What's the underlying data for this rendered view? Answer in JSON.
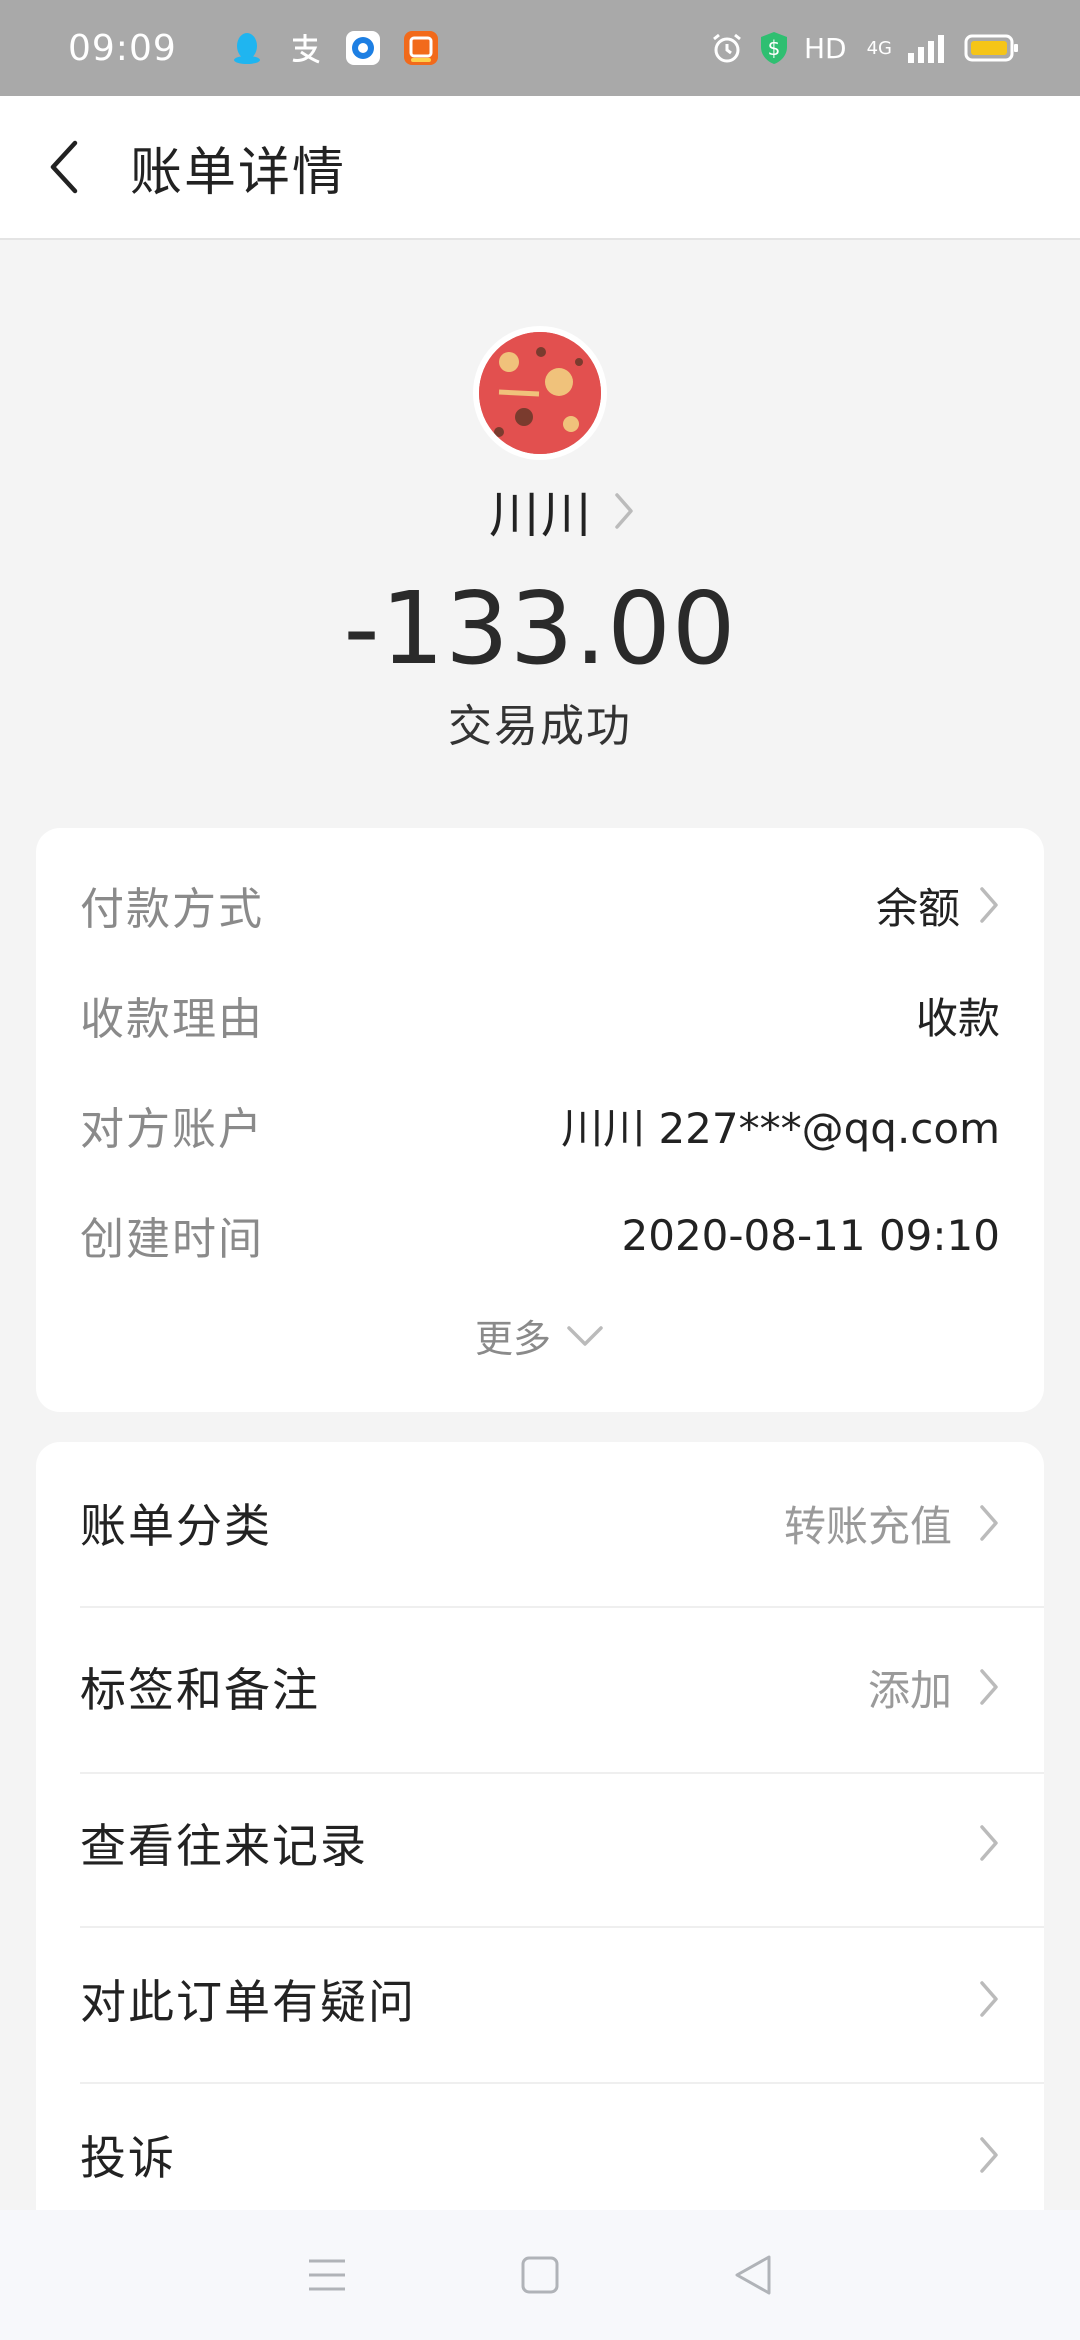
{
  "status_bar": {
    "time": "09:09",
    "hd_label": "HD",
    "network_label": "4G",
    "icons": [
      "qq-icon",
      "alipay-icon",
      "browser-icon",
      "shop-app-icon",
      "alarm-icon",
      "shield-icon",
      "signal-icon",
      "battery-icon"
    ]
  },
  "nav": {
    "title": "账单详情"
  },
  "header": {
    "name": "川川",
    "amount": "-133.00",
    "status": "交易成功"
  },
  "details": [
    {
      "label": "付款方式",
      "value": "余额",
      "has_chevron": true
    },
    {
      "label": "收款理由",
      "value": "收款",
      "has_chevron": false
    },
    {
      "label": "对方账户",
      "value": "川川 227***@qq.com",
      "has_chevron": false
    },
    {
      "label": "创建时间",
      "value": "2020-08-11 09:10",
      "has_chevron": false
    }
  ],
  "more_label": "更多",
  "menu": [
    {
      "label": "账单分类",
      "value": "转账充值"
    },
    {
      "label": "标签和备注",
      "value": "添加"
    },
    {
      "label": "查看往来记录",
      "value": ""
    },
    {
      "label": "对此订单有疑问",
      "value": ""
    },
    {
      "label": "投诉",
      "value": ""
    }
  ],
  "colors": {
    "status_bar_bg": "#a9a9a9",
    "page_bg": "#f4f4f4",
    "card_bg": "#ffffff",
    "label_gray": "#8a8a8a",
    "battery_yellow": "#f5c518",
    "shield_green": "#2fbf71"
  }
}
